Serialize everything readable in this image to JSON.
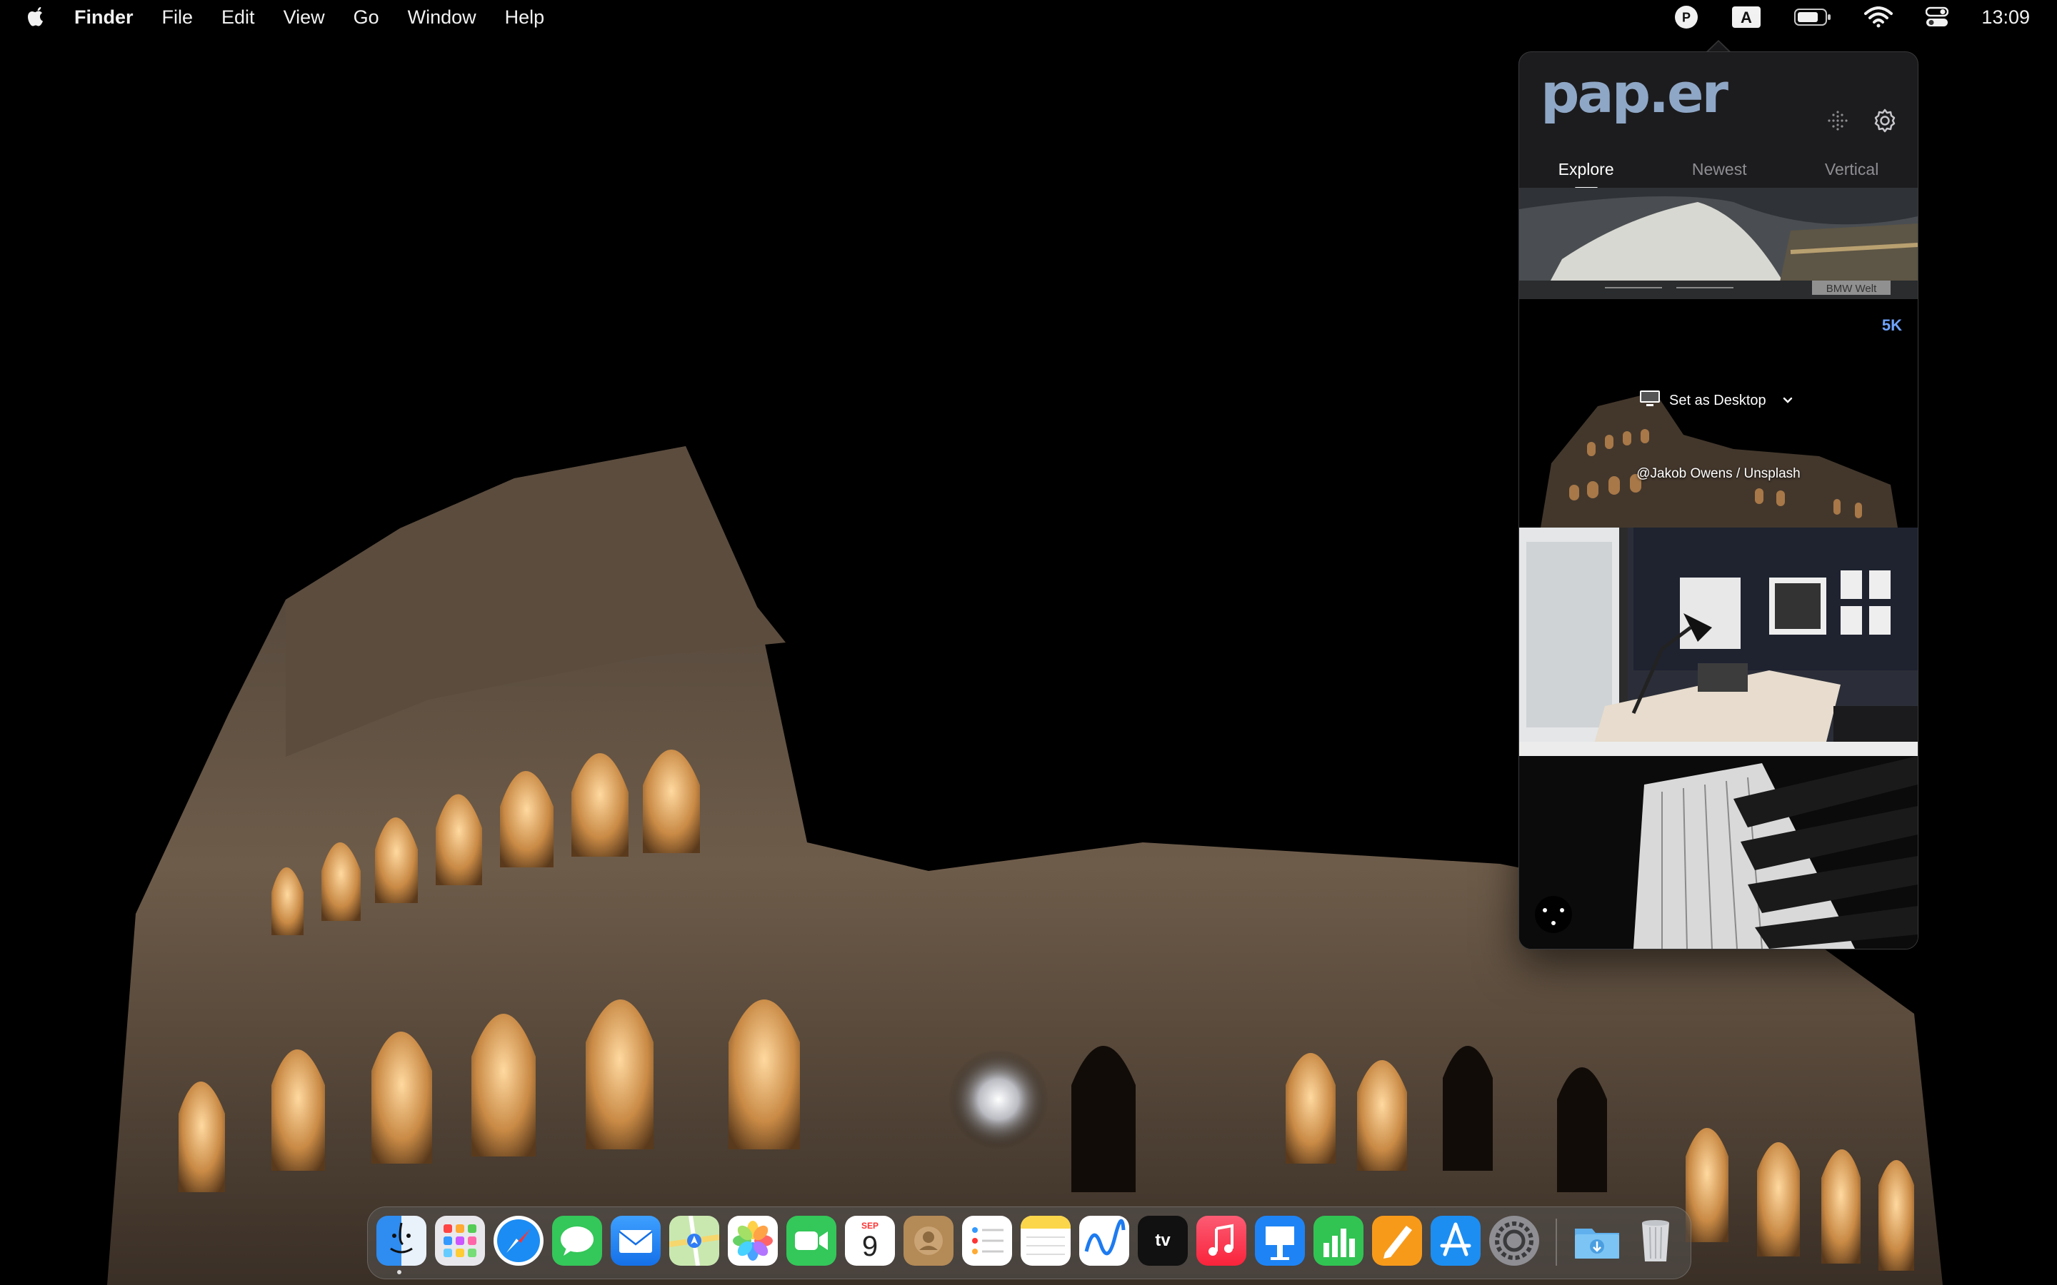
{
  "menubar": {
    "apple_icon": "apple-logo-icon",
    "app_name": "Finder",
    "menus": [
      "File",
      "Edit",
      "View",
      "Go",
      "Window",
      "Help"
    ],
    "status_icons": [
      "paper-app-icon",
      "input-source-icon",
      "battery-icon",
      "wifi-icon",
      "control-center-icon"
    ],
    "input_source_label": "A",
    "paper_icon_label": "P",
    "clock": "13:09"
  },
  "popover": {
    "logo_text": "pap.er",
    "tabs": [
      {
        "label": "Explore",
        "active": true
      },
      {
        "label": "Newest",
        "active": false
      },
      {
        "label": "Vertical",
        "active": false
      }
    ],
    "cards": [
      {
        "name": "bmw-welt",
        "caption": "BMW Welt"
      },
      {
        "name": "colosseum",
        "resolution_badge": "5K",
        "action_label": "Set as Desktop",
        "credit": "@Jakob Owens / Unsplash"
      },
      {
        "name": "office-interior"
      },
      {
        "name": "building-architecture"
      }
    ]
  },
  "dock": {
    "apps": [
      "Finder",
      "Launchpad",
      "Safari",
      "Messages",
      "Mail",
      "Maps",
      "Photos",
      "FaceTime",
      "Calendar",
      "Contacts",
      "Reminders",
      "Notes",
      "Freeform",
      "TV",
      "Music",
      "Keynote",
      "Numbers",
      "Pages",
      "App Store",
      "System Settings",
      "Downloads",
      "Trash"
    ],
    "calendar_month": "SEP",
    "calendar_day": "9"
  },
  "colors": {
    "popover_bg": "#1c1c1e",
    "badge_5k": "#6fa3ff",
    "logo": "#8fa7c6"
  }
}
